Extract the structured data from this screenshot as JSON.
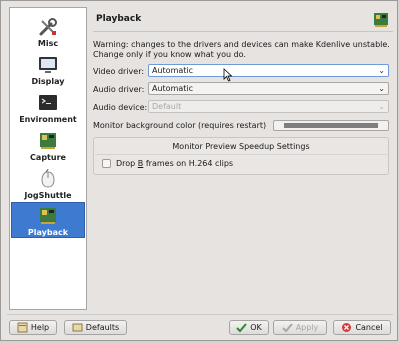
{
  "sidebar": {
    "items": [
      {
        "label": "Misc",
        "icon": "wrench-screwdriver-icon"
      },
      {
        "label": "Display",
        "icon": "monitor-icon"
      },
      {
        "label": "Environment",
        "icon": "terminal-icon"
      },
      {
        "label": "Capture",
        "icon": "capture-card-icon"
      },
      {
        "label": "JogShuttle",
        "icon": "jog-shuttle-icon"
      },
      {
        "label": "Playback",
        "icon": "playback-card-icon",
        "active": true
      }
    ]
  },
  "page": {
    "title": "Playback",
    "warning": "Warning: changes to the drivers and devices can make Kdenlive unstable. Change only if you know what you do.",
    "video_driver_label": "Video driver:",
    "video_driver_value": "Automatic",
    "audio_driver_label": "Audio driver:",
    "audio_driver_value": "Automatic",
    "audio_device_label": "Audio device:",
    "audio_device_value": "Default",
    "monitor_bg_label": "Monitor background color (requires restart)",
    "group_title": "Monitor Preview Speedup Settings",
    "drop_frames_label_pre": "Drop ",
    "drop_frames_label_accel": "B",
    "drop_frames_label_post": " frames on H.264 clips"
  },
  "buttons": {
    "help": "Help",
    "defaults": "Defaults",
    "ok": "OK",
    "apply": "Apply",
    "cancel": "Cancel"
  },
  "colors": {
    "accent": "#3f7ad1",
    "monitor_bg": "#7e7e7e"
  }
}
